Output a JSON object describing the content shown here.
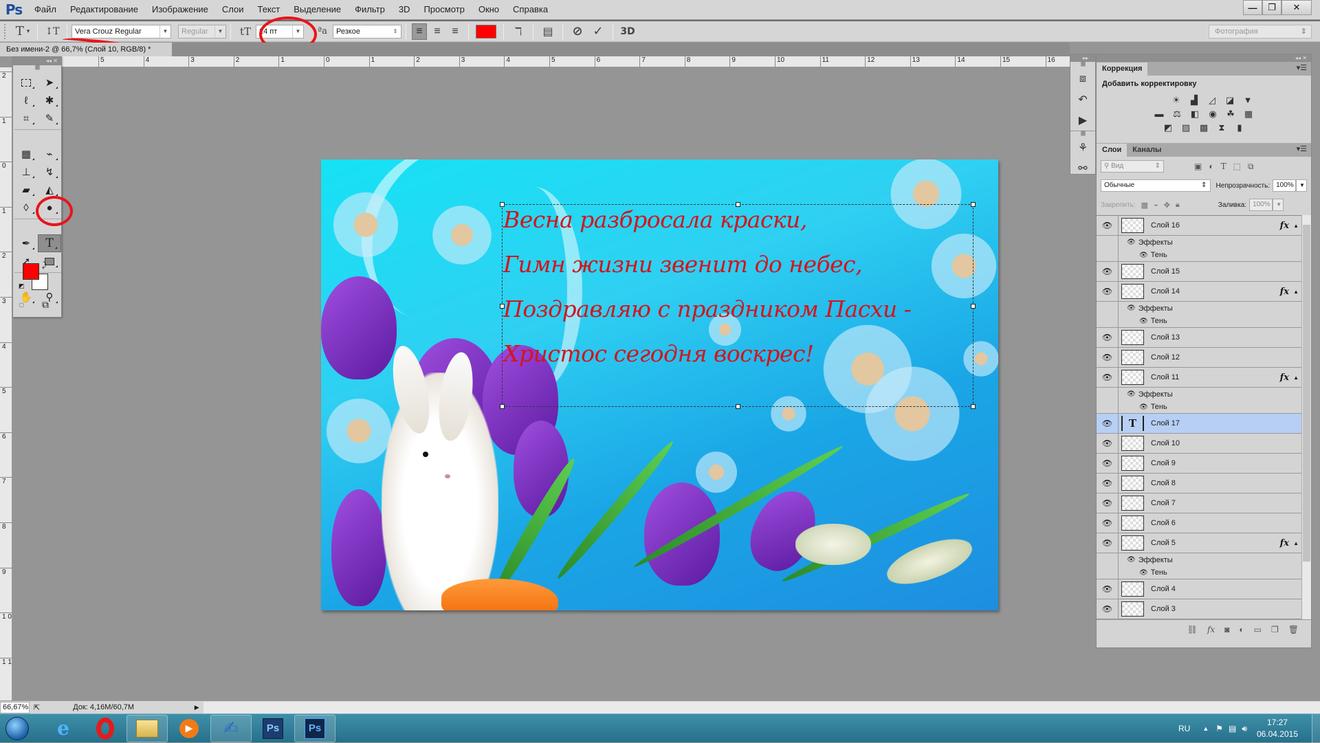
{
  "app": {
    "logo": "Ps"
  },
  "menu": [
    "Файл",
    "Редактирование",
    "Изображение",
    "Слои",
    "Текст",
    "Выделение",
    "Фильтр",
    "3D",
    "Просмотр",
    "Окно",
    "Справка"
  ],
  "window_controls": {
    "minimize": "—",
    "restore": "❐",
    "close": "✕"
  },
  "options_bar": {
    "tool_icon": "T",
    "orientation_icon": "↕T",
    "font_family": "Vera Crouz Regular",
    "font_style": "Regular",
    "size_icon": "tT",
    "font_size": "24 пт",
    "aa_icon": "ªa",
    "antialias": "Резкое",
    "align": [
      "left",
      "center",
      "right"
    ],
    "align_active": "left",
    "text_color": "#ff0000",
    "warp_icon": "warp-text",
    "panel_icon": "character-panel",
    "cancel_icon": "⊘",
    "commit_icon": "✓",
    "threed_label": "3D",
    "workspace": "Фотография"
  },
  "document": {
    "tab_title": "Без имени-2 @ 66,7% (Слой 10, RGB/8) *",
    "poem": [
      "Весна разбросала краски,",
      "Гимн жизни звенит до небес,",
      "Поздравляю с праздником Пасхи -",
      "Христос сегодня воскрес!"
    ]
  },
  "ruler_h": [
    "5",
    "4",
    "3",
    "2",
    "1",
    "0",
    "1",
    "2",
    "3",
    "4",
    "5",
    "6",
    "7",
    "8",
    "9",
    "10",
    "11",
    "12",
    "13",
    "14",
    "15",
    "16"
  ],
  "ruler_v": [
    "2",
    "1",
    "0",
    "1",
    "2",
    "3",
    "4",
    "5",
    "6",
    "7",
    "8",
    "9",
    "1 0",
    "1 1"
  ],
  "tools": {
    "foreground_color": "#ff0000",
    "background_color": "#ffffff",
    "active": "type-tool"
  },
  "correction_panel": {
    "tab": "Коррекция",
    "title": "Добавить корректировку"
  },
  "layers_panel": {
    "tabs": [
      "Слои",
      "Каналы"
    ],
    "filter_placeholder": "Вид",
    "blend_mode": "Обычные",
    "opacity_label": "Непрозрачность:",
    "opacity": "100%",
    "lock_label": "Закрепить:",
    "fill_label": "Заливка:",
    "fill": "100%",
    "effects_label": "Эффекты",
    "shadow_label": "Тень",
    "layers": [
      {
        "name": "Слой 16",
        "fx": true
      },
      {
        "name": "Слой 15",
        "fx": false
      },
      {
        "name": "Слой 14",
        "fx": true
      },
      {
        "name": "Слой 13",
        "fx": false
      },
      {
        "name": "Слой 12",
        "fx": false
      },
      {
        "name": "Слой 11",
        "fx": true
      },
      {
        "name": "Слой 17",
        "fx": false,
        "type": "text",
        "selected": true
      },
      {
        "name": "Слой 10",
        "fx": false
      },
      {
        "name": "Слой 9",
        "fx": false
      },
      {
        "name": "Слой 8",
        "fx": false
      },
      {
        "name": "Слой 7",
        "fx": false
      },
      {
        "name": "Слой 6",
        "fx": false
      },
      {
        "name": "Слой 5",
        "fx": true
      },
      {
        "name": "Слой 4",
        "fx": false
      },
      {
        "name": "Слой 3",
        "fx": false
      }
    ]
  },
  "status_bar": {
    "zoom": "66,67%",
    "doc_info": "Док: 4,16M/60,7M"
  },
  "taskbar": {
    "apps": [
      "internet-explorer",
      "opera",
      "explorer",
      "media-player",
      "word",
      "photoshop",
      "photoshop-active"
    ],
    "language": "RU",
    "time": "17:27",
    "date": "06.04.2015"
  }
}
